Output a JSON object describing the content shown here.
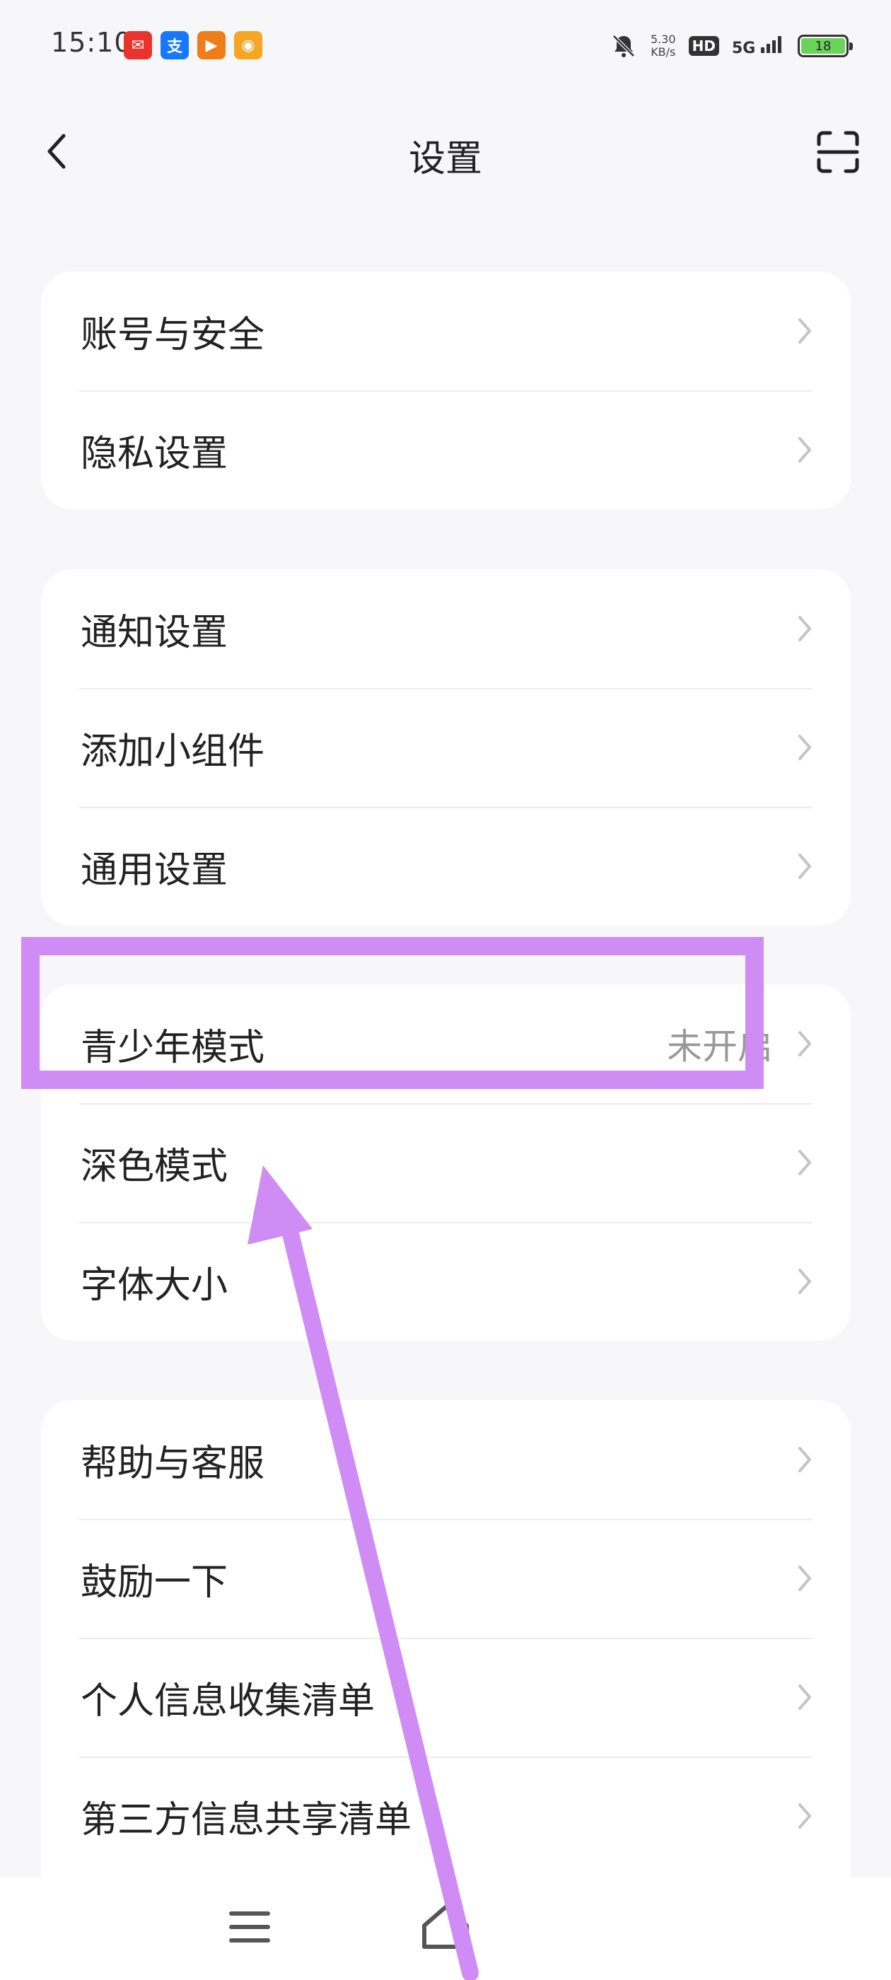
{
  "status_bar": {
    "time": "15:10",
    "net_speed_value": "5.30",
    "net_speed_unit": "KB/s",
    "hd_label": "HD",
    "network_label": "5G",
    "battery_level": "18",
    "app_icons": [
      {
        "name": "news-app-icon",
        "color": "#e8342c",
        "glyph": "✉"
      },
      {
        "name": "alipay-app-icon",
        "color": "#1677ff",
        "glyph": "支"
      },
      {
        "name": "video-app-icon",
        "color": "#ef7d1a",
        "glyph": "▶"
      },
      {
        "name": "weibo-app-icon",
        "color": "#f5a623",
        "glyph": "◉"
      }
    ]
  },
  "header": {
    "title": "设置"
  },
  "groups": [
    {
      "items": [
        {
          "label": "账号与安全"
        },
        {
          "label": "隐私设置"
        }
      ]
    },
    {
      "items": [
        {
          "label": "通知设置"
        },
        {
          "label": "添加小组件"
        },
        {
          "label": "通用设置"
        }
      ]
    },
    {
      "items": [
        {
          "label": "青少年模式",
          "value": "未开启"
        },
        {
          "label": "深色模式"
        },
        {
          "label": "字体大小"
        }
      ]
    },
    {
      "items": [
        {
          "label": "帮助与客服"
        },
        {
          "label": "鼓励一下"
        },
        {
          "label": "个人信息收集清单"
        },
        {
          "label": "第三方信息共享清单"
        }
      ]
    }
  ],
  "annotation_color": "#cf8cf5"
}
